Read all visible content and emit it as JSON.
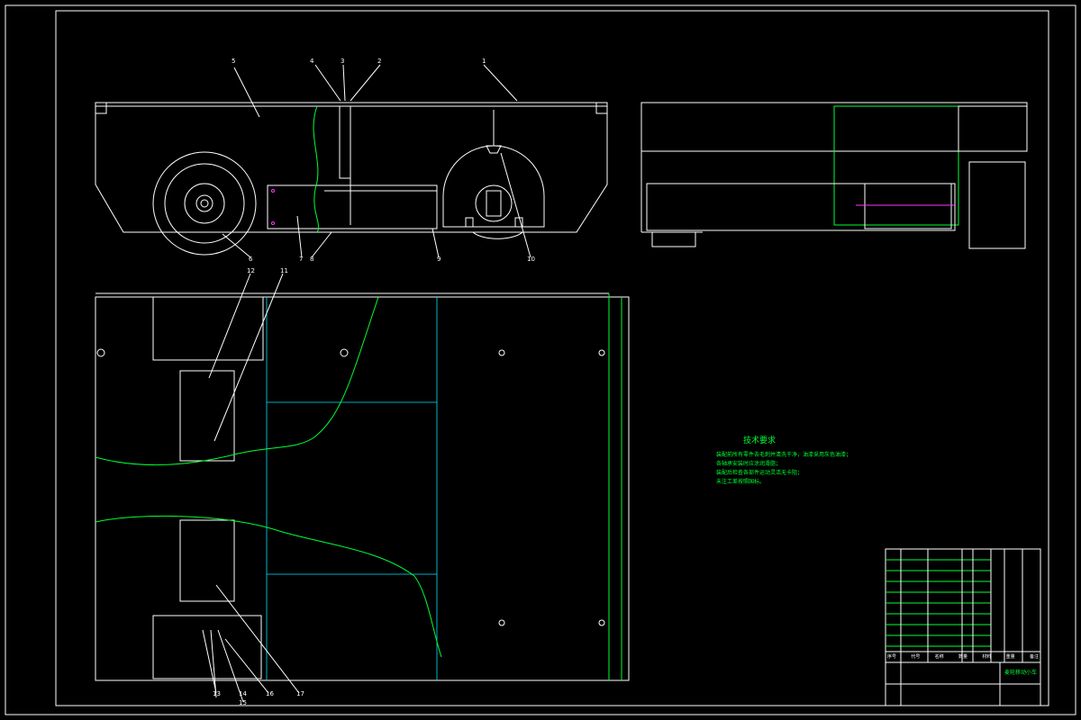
{
  "drawing": {
    "callouts_front": [
      "5",
      "4",
      "3",
      "2",
      "1",
      "6",
      "7",
      "8",
      "9",
      "10"
    ],
    "callouts_top": [
      "12",
      "11",
      "13",
      "14",
      "15",
      "16",
      "17"
    ]
  },
  "tech_req": {
    "title": "技术要求",
    "lines": [
      "装配前所有零件去毛刺并清洗干净，油漆采用灰色油漆；",
      "各轴承安装时应涂润滑脂；",
      "装配后检查各部件运动灵活无卡阻；",
      "未注工差按照国标。"
    ]
  },
  "title_block": {
    "header": [
      "序号",
      "代号",
      "名称",
      "数量",
      "材料",
      "重量",
      "备注"
    ],
    "stamp": "麦轮移动小车"
  }
}
